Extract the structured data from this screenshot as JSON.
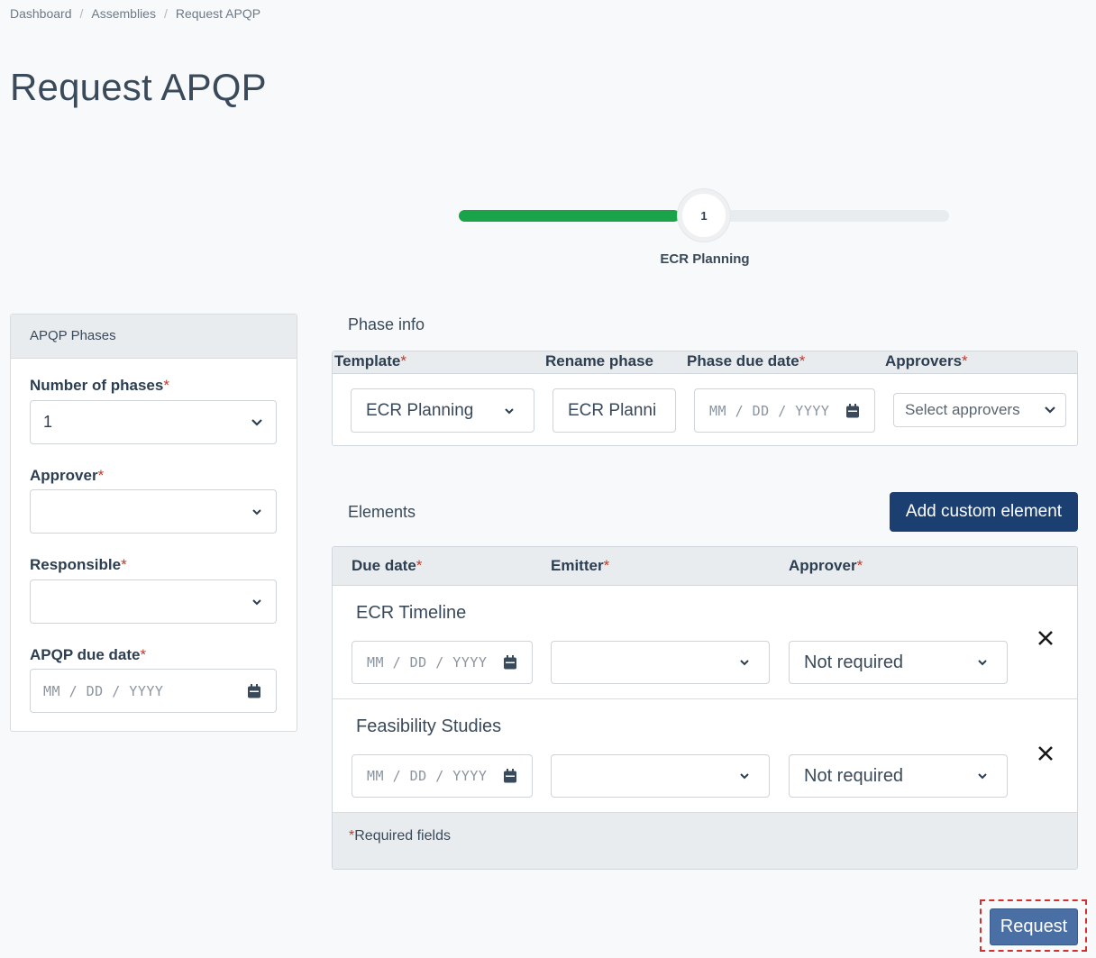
{
  "breadcrumb": {
    "items": [
      "Dashboard",
      "Assemblies",
      "Request APQP"
    ]
  },
  "page": {
    "title": "Request APQP"
  },
  "stepper": {
    "step_number": "1",
    "step_label": "ECR Planning",
    "progress_fraction": 0.45,
    "fill_color": "#1aa34a"
  },
  "left_panel": {
    "header": "APQP Phases",
    "fields": {
      "phases_label": "Number of phases",
      "phases_value": "1",
      "approver_label": "Approver",
      "approver_value": "",
      "responsible_label": "Responsible",
      "responsible_value": "",
      "due_label": "APQP due date",
      "due_placeholder": "MM / DD / YYYY"
    }
  },
  "required_marker": "*",
  "phase_info": {
    "title": "Phase info",
    "columns": [
      "Template",
      "Rename phase",
      "Phase due date",
      "Approvers"
    ],
    "template_value": "ECR Planning",
    "rename_value": "ECR Planni",
    "due_placeholder": "MM / DD / YYYY",
    "approvers_placeholder": "Select approvers"
  },
  "elements": {
    "title": "Elements",
    "add_button": "Add custom element",
    "columns": [
      "Due date",
      "Emitter",
      "Approver"
    ],
    "rows": [
      {
        "name": "ECR Timeline",
        "due_placeholder": "MM / DD / YYYY",
        "emitter": "",
        "approver": "Not required"
      },
      {
        "name": "Feasibility Studies",
        "due_placeholder": "MM / DD / YYYY",
        "emitter": "",
        "approver": "Not required"
      }
    ],
    "footer_note": "Required fields"
  },
  "actions": {
    "request_button": "Request"
  },
  "colors": {
    "primary_dark": "#1c3f72",
    "primary": "#4a6fa5",
    "success": "#1aa34a",
    "required": "#c0392b"
  }
}
